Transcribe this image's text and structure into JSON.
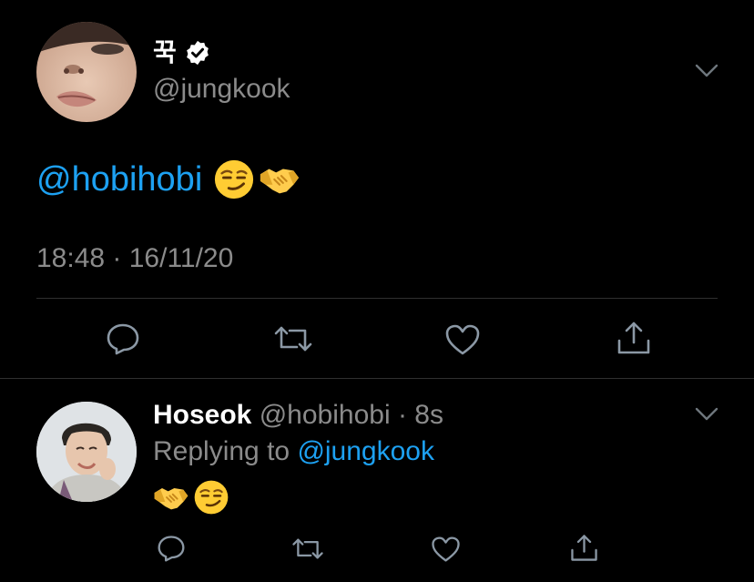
{
  "main_tweet": {
    "display_name": "꾹",
    "handle": "@jungkook",
    "verified": true,
    "text_mention": "@hobihobi",
    "emojis": [
      "smirking-face",
      "handshake"
    ],
    "timestamp": "18:48 · 16/11/20"
  },
  "reply": {
    "display_name": "Hoseok",
    "handle": "@hobihobi",
    "separator": " · ",
    "age": "8s",
    "replying_prefix": "Replying to ",
    "replying_to": "@jungkook",
    "emojis": [
      "handshake",
      "smirking-face"
    ]
  },
  "colors": {
    "background": "#000000",
    "link": "#1da1f2",
    "secondary_text": "#8b8b8b",
    "primary_text": "#ffffff",
    "divider": "#2f2f2f"
  }
}
